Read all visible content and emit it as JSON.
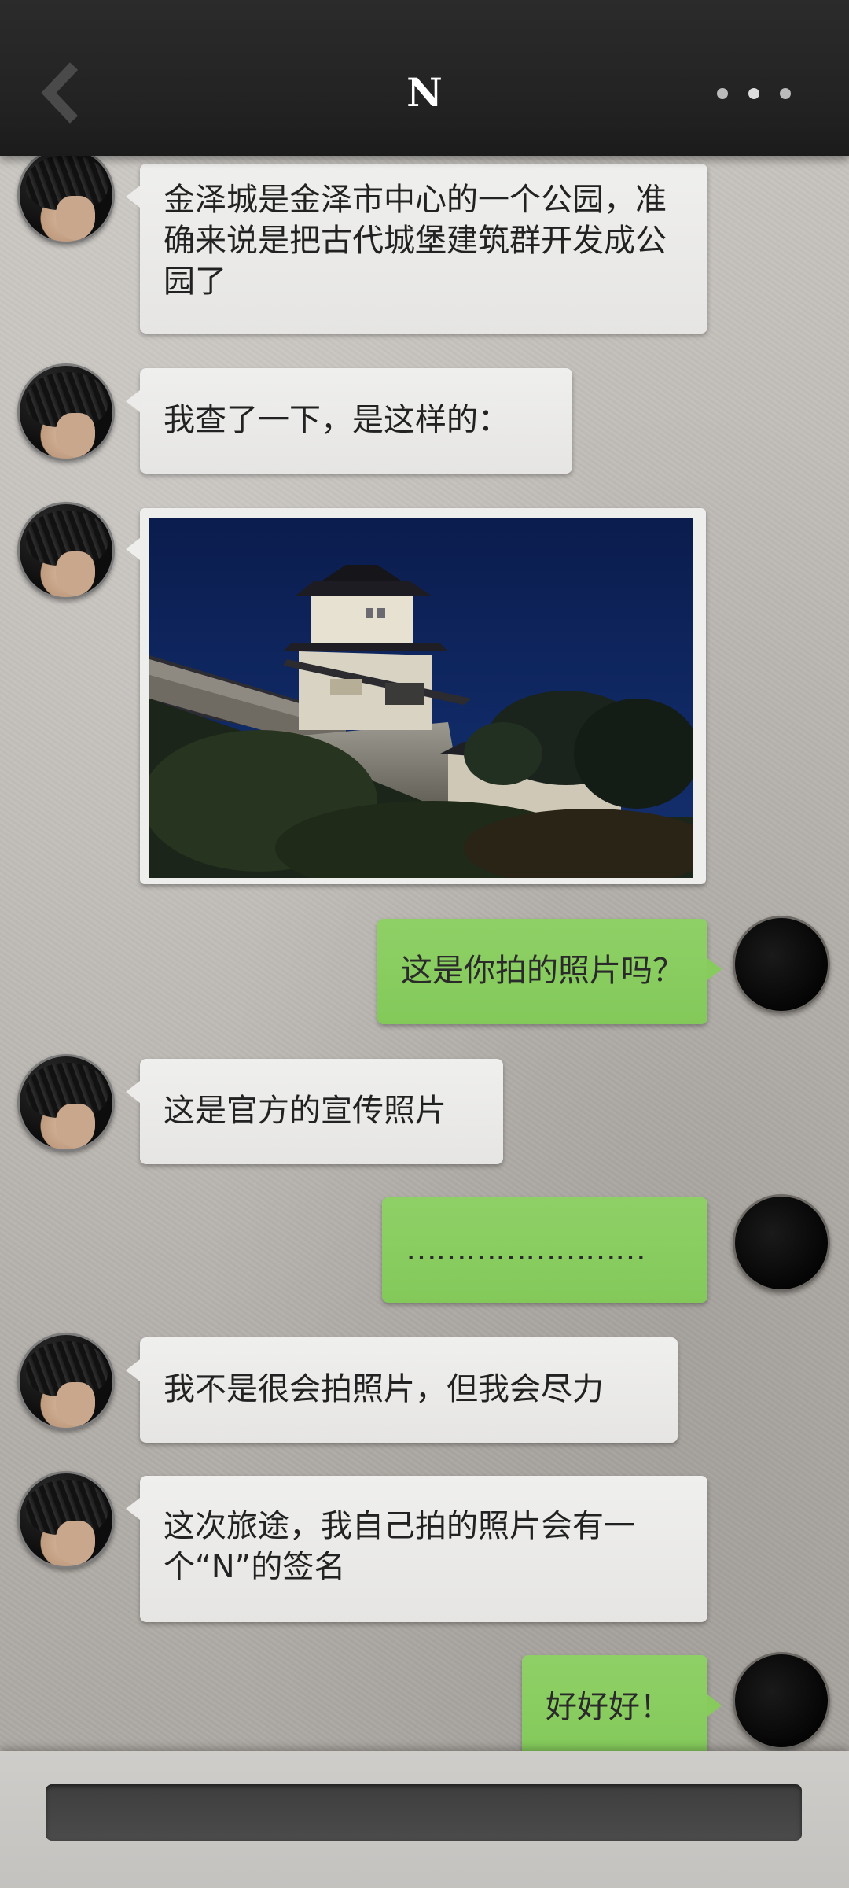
{
  "header": {
    "title": "N",
    "back_icon": "chevron-left-icon",
    "more_icon": "more-dots-icon"
  },
  "messages": [
    {
      "side": "left",
      "type": "text",
      "text": "金泽城是金泽市中心的一个公园，准确来说是把古代城堡建筑群开发成公园了"
    },
    {
      "side": "left",
      "type": "text",
      "text": "我查了一下，是这样的："
    },
    {
      "side": "left",
      "type": "image",
      "image": "kanazawa-castle-night-photo"
    },
    {
      "side": "right",
      "type": "text",
      "text": "这是你拍的照片吗？"
    },
    {
      "side": "left",
      "type": "text",
      "text": "这是官方的宣传照片"
    },
    {
      "side": "right",
      "type": "text",
      "text": "……………………"
    },
    {
      "side": "left",
      "type": "text",
      "text": "我不是很会拍照片，但我会尽力"
    },
    {
      "side": "left",
      "type": "text",
      "text": "这次旅途，我自己拍的照片会有一个“N”的签名"
    },
    {
      "side": "right",
      "type": "text",
      "text": "好好好！"
    }
  ],
  "composer": {
    "input_value": ""
  },
  "colors": {
    "incoming_bubble": "#ecebe9",
    "outgoing_bubble": "#8ace60",
    "header_bg": "#232323"
  }
}
